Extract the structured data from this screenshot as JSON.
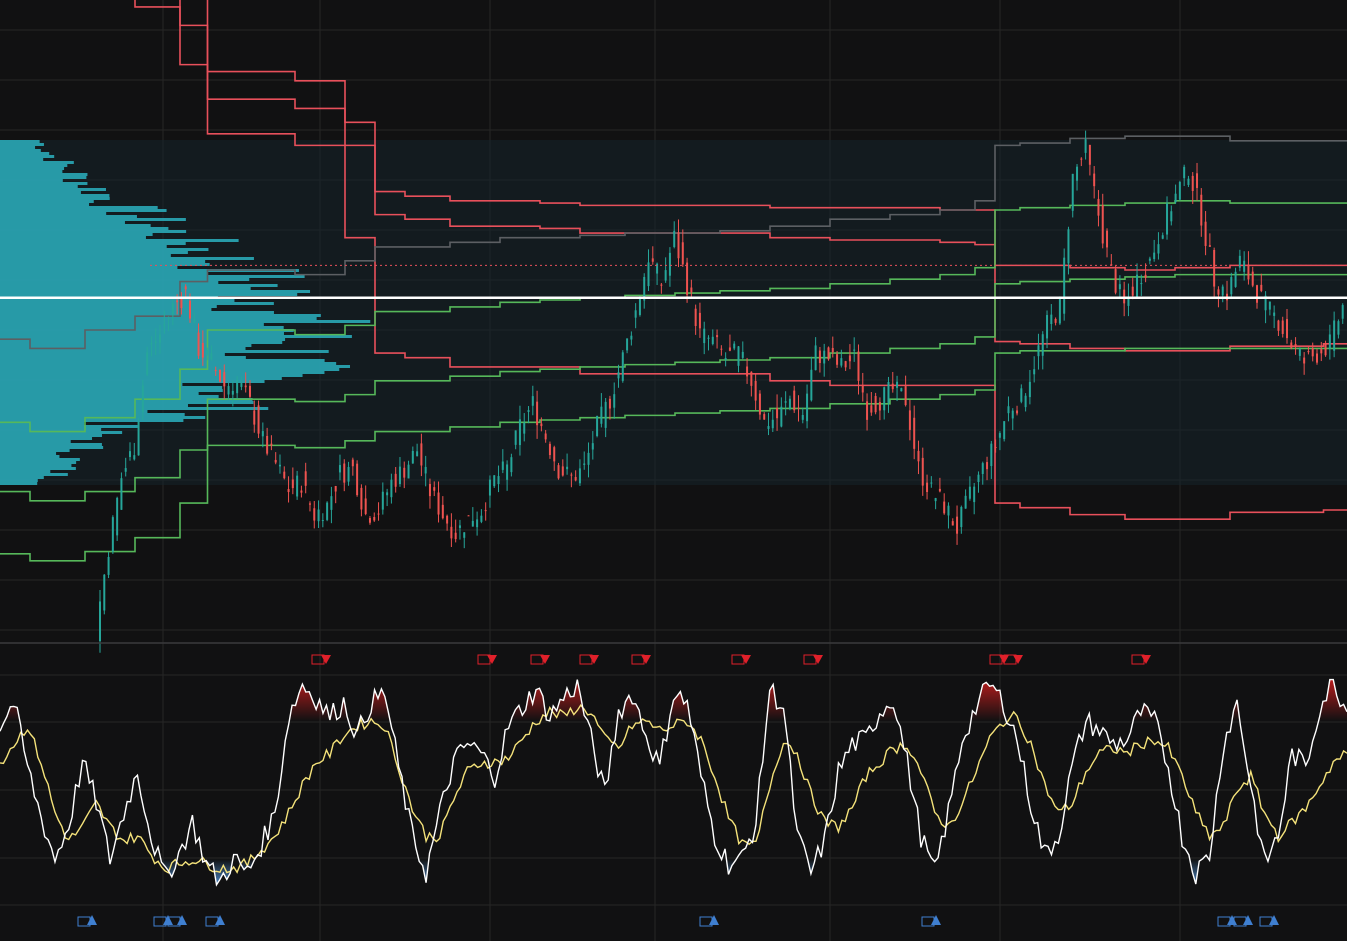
{
  "chart_data": {
    "type": "line",
    "title": "",
    "colors": {
      "background": "#111112",
      "grid": "#262626",
      "band_upper": "#e8505b",
      "band_lower": "#56b85a",
      "basis": "#5c5f63",
      "candle_up": "#26a69a",
      "candle_down": "#ef5350",
      "profile": "#2bb0c0",
      "poc_line": "#ffffff",
      "osc_fast": "#ffffff",
      "osc_slow": "#f4e27a",
      "ob_fill": "#b71c1c",
      "os_fill": "#4a86c5",
      "sell_marker": "#e0202a",
      "buy_marker": "#3f7fd0"
    },
    "price_panel": {
      "x": [
        0,
        60,
        110,
        160,
        200,
        215,
        260,
        330,
        360,
        390,
        420,
        480,
        520,
        560,
        600,
        650,
        700,
        740,
        800,
        860,
        920,
        960,
        990,
        1000,
        1040,
        1100,
        1150,
        1200,
        1260,
        1300,
        1347
      ],
      "bands": [
        {
          "values": [
            350,
            362,
            345,
            330,
            280,
            215,
            215,
            210,
            170,
            120,
            118,
            114,
            114,
            114,
            111,
            111,
            111,
            111,
            108,
            106,
            106,
            106,
            106,
            55,
            53,
            50,
            48,
            48,
            51,
            51,
            52
          ]
        },
        {
          "values": [
            330,
            338,
            318,
            300,
            262,
            242,
            242,
            238,
            220,
            180,
            178,
            175,
            175,
            174,
            172,
            172,
            172,
            172,
            170,
            169,
            169,
            168,
            167,
            125,
            124,
            122,
            121,
            121,
            123,
            123,
            124
          ]
        },
        {
          "values": [
            298,
            304,
            288,
            270,
            245,
            230,
            230,
            226,
            210,
            190,
            188,
            186,
            186,
            185,
            184,
            184,
            184,
            184,
            183,
            183,
            183,
            182,
            182,
            158,
            158,
            157,
            156,
            157,
            158,
            158,
            158
          ]
        },
        {
          "values": [
            126,
            122,
            130,
            136,
            151,
            156,
            156,
            154,
            160,
            166,
            166,
            168,
            170,
            170,
            171,
            172,
            172,
            173,
            175,
            178,
            180,
            182,
            186,
            210,
            211,
            213,
            214,
            214,
            212,
            212,
            212
          ]
        },
        {
          "values": [
            90,
            86,
            92,
            100,
            113,
            130,
            130,
            128,
            132,
            138,
            138,
            140,
            142,
            143,
            144,
            145,
            146,
            147,
            148,
            150,
            152,
            154,
            157,
            182,
            183,
            184,
            185,
            186,
            185,
            185,
            185
          ]
        },
        {
          "values": [
            60,
            56,
            60,
            66,
            78,
            100,
            100,
            99,
            102,
            108,
            108,
            110,
            112,
            113,
            114,
            115,
            116,
            117,
            118,
            120,
            122,
            124,
            127,
            150,
            151,
            152,
            153,
            154,
            154,
            154,
            154
          ]
        },
        {
          "values": [
            33,
            30,
            34,
            40,
            55,
            80,
            80,
            79,
            82,
            86,
            86,
            88,
            90,
            91,
            92,
            93,
            94,
            95,
            96,
            98,
            100,
            102,
            104,
            120,
            121,
            121,
            122,
            122,
            122,
            122,
            122
          ]
        }
      ],
      "price": [
        0,
        36,
        66,
        80,
        120,
        128,
        140,
        146,
        122,
        116,
        106,
        108,
        98,
        82,
        72,
        61,
        64,
        50,
        54,
        68,
        70,
        50,
        52,
        64,
        70,
        78,
        60,
        50,
        42,
        48,
        52,
        65,
        70,
        88,
        98,
        84,
        70,
        66,
        70,
        88,
        100,
        118,
        138,
        162,
        150,
        170,
        150,
        128,
        125,
        118,
        120,
        108,
        90,
        92,
        100,
        94,
        120,
        118,
        114,
        118,
        96,
        100,
        104,
        100,
        70,
        60,
        54,
        44,
        58,
        70,
        80,
        96,
        100,
        116,
        132,
        140,
        196,
        208,
        180,
        155,
        140,
        152,
        160,
        176,
        188,
        200,
        180,
        152,
        146,
        160,
        150,
        140,
        134,
        124,
        116,
        120,
        124,
        140
      ],
      "poc": 144,
      "dotted_level": 158,
      "ylim": [
        0,
        260
      ]
    },
    "oscillator_panel": {
      "fast": [
        78,
        88,
        60,
        38,
        20,
        35,
        62,
        45,
        20,
        40,
        58,
        30,
        12,
        22,
        36,
        18,
        10,
        20,
        14,
        26,
        40,
        82,
        96,
        90,
        82,
        88,
        74,
        88,
        92,
        60,
        30,
        14,
        40,
        62,
        70,
        66,
        56,
        78,
        86,
        94,
        82,
        90,
        96,
        72,
        48,
        84,
        92,
        74,
        60,
        92,
        88,
        56,
        30,
        18,
        20,
        36,
        94,
        86,
        30,
        14,
        28,
        58,
        70,
        72,
        84,
        90,
        62,
        30,
        14,
        40,
        72,
        86,
        96,
        88,
        72,
        44,
        22,
        30,
        60,
        80,
        76,
        70,
        72,
        84,
        80,
        60,
        30,
        14,
        22,
        70,
        88,
        52,
        18,
        30,
        66,
        60,
        86,
        98,
        84
      ],
      "slow": [
        62,
        70,
        78,
        62,
        40,
        28,
        34,
        44,
        34,
        28,
        30,
        22,
        16,
        18,
        20,
        18,
        16,
        16,
        18,
        24,
        30,
        40,
        52,
        62,
        66,
        74,
        78,
        80,
        78,
        60,
        42,
        30,
        30,
        46,
        58,
        62,
        62,
        64,
        72,
        80,
        84,
        82,
        86,
        84,
        72,
        68,
        78,
        80,
        76,
        78,
        80,
        72,
        56,
        38,
        26,
        26,
        52,
        72,
        66,
        48,
        36,
        34,
        42,
        56,
        62,
        68,
        70,
        58,
        40,
        34,
        44,
        58,
        72,
        80,
        82,
        70,
        52,
        40,
        44,
        58,
        66,
        68,
        66,
        70,
        72,
        68,
        56,
        40,
        30,
        34,
        50,
        56,
        40,
        30,
        36,
        42,
        52,
        62,
        66
      ],
      "overbought": 80,
      "oversold": 20,
      "ylim": [
        0,
        100
      ]
    },
    "markers": {
      "sell_x": [
        326,
        492,
        545,
        594,
        646,
        746,
        818,
        1004,
        1018,
        1146
      ],
      "buy_x": [
        92,
        168,
        182,
        220,
        714,
        936,
        1232,
        1248,
        1274
      ]
    },
    "xlabel": "",
    "ylabel": ""
  }
}
